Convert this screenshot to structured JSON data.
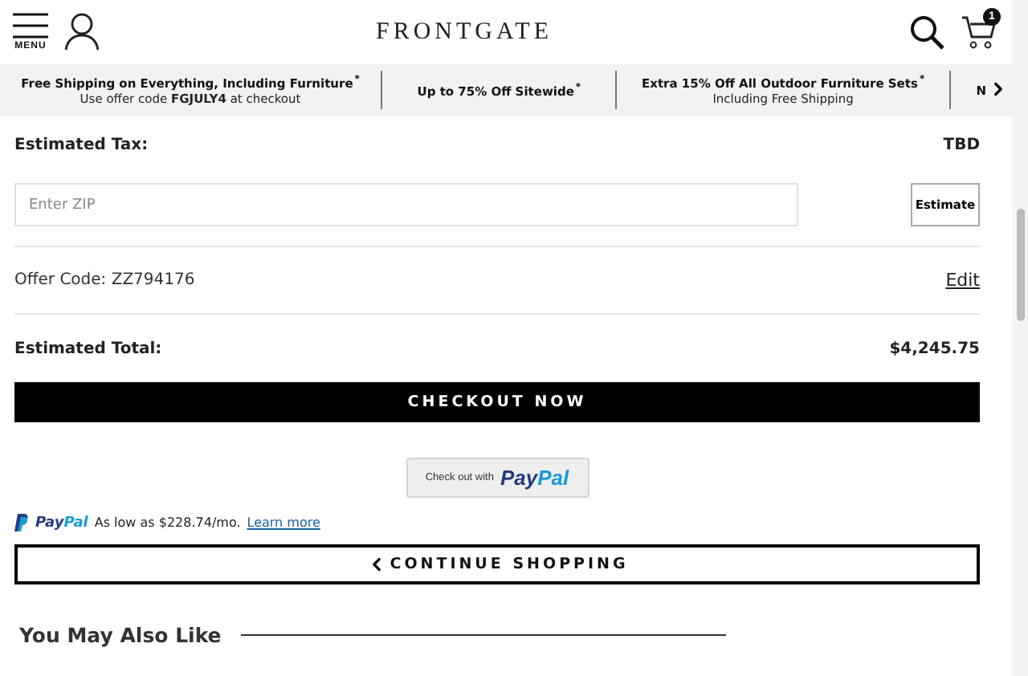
{
  "header": {
    "menu_label": "MENU",
    "logo": "FRONTGATE",
    "cart_count": "1"
  },
  "promos": [
    {
      "title": "Free Shipping on Everything, Including Furniture",
      "mark": "*",
      "subtitle": "Use offer code **FGJULY4** at checkout"
    },
    {
      "title": "Up to 75% Off Sitewide",
      "mark": "*"
    },
    {
      "title": "Extra 15% Off All Outdoor Furniture Sets",
      "mark": "*",
      "subtitle": "Including Free Shipping"
    },
    {
      "title": "N"
    }
  ],
  "summary": {
    "tax_label": "Estimated Tax:",
    "tax_value": "TBD",
    "zip": {
      "placeholder": "Enter ZIP"
    },
    "estimate_button": "Estimate",
    "offer_code": "Offer Code: ZZ794176",
    "edit_link": "Edit",
    "total_label": "Estimated Total:",
    "total_value": "$4,245.75"
  },
  "checkout_button": "CHECKOUT NOW",
  "paypal_button": {
    "prefix": "Check out with",
    "brand_dark": "Pay",
    "brand_light": "Pal"
  },
  "paypal_credit": {
    "brand_dark": "Pay",
    "brand_light": "Pal",
    "text": "As low as $228.74/mo.",
    "link": "Learn more"
  },
  "continue_button": "CONTINUE SHOPPING",
  "recommendations": {
    "title": "You May Also Like"
  }
}
